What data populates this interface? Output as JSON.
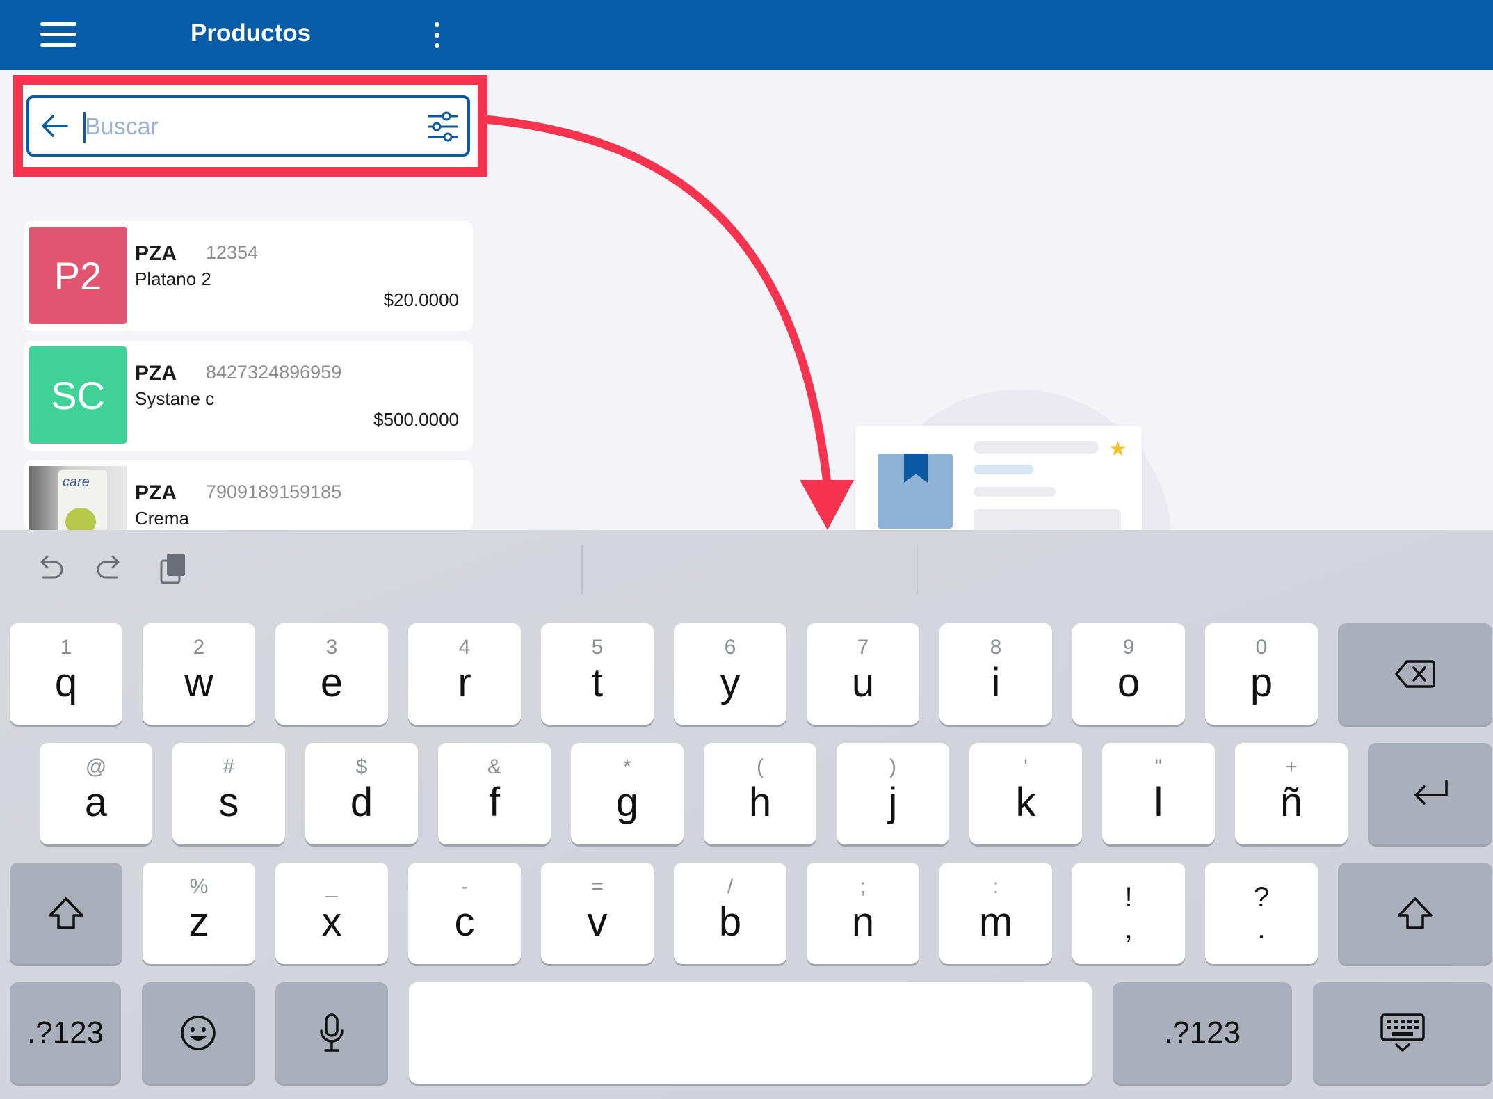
{
  "appbar": {
    "title": "Productos",
    "menu_icon": "hamburger-menu-icon",
    "overflow_icon": "more-vertical-icon",
    "color": "#075ca8"
  },
  "search": {
    "placeholder": "Buscar",
    "value": "",
    "back_icon": "arrow-left-icon",
    "filter_icon": "sliders-filter-icon",
    "highlight_color": "#f6344f"
  },
  "products": [
    {
      "initials": "P2",
      "unit": "PZA",
      "code": "12354",
      "name": "Platano 2",
      "price": "$20.0000",
      "color": "#e05670"
    },
    {
      "initials": "SC",
      "unit": "PZA",
      "code": "8427324896959",
      "name": "Systane c",
      "price": "$500.0000",
      "color": "#40d197"
    },
    {
      "initials": "",
      "unit": "PZA",
      "code": "7909189159185",
      "name": "Crema",
      "price": "",
      "photo_text": "care"
    }
  ],
  "keyboard": {
    "toolbar": [
      "undo-icon",
      "redo-icon",
      "clipboard-icon"
    ],
    "row1": [
      {
        "hint": "1",
        "key": "q"
      },
      {
        "hint": "2",
        "key": "w"
      },
      {
        "hint": "3",
        "key": "e"
      },
      {
        "hint": "4",
        "key": "r"
      },
      {
        "hint": "5",
        "key": "t"
      },
      {
        "hint": "6",
        "key": "y"
      },
      {
        "hint": "7",
        "key": "u"
      },
      {
        "hint": "8",
        "key": "i"
      },
      {
        "hint": "9",
        "key": "o"
      },
      {
        "hint": "0",
        "key": "p"
      }
    ],
    "row2": [
      {
        "hint": "@",
        "key": "a"
      },
      {
        "hint": "#",
        "key": "s"
      },
      {
        "hint": "$",
        "key": "d"
      },
      {
        "hint": "&",
        "key": "f"
      },
      {
        "hint": "*",
        "key": "g"
      },
      {
        "hint": "(",
        "key": "h"
      },
      {
        "hint": ")",
        "key": "j"
      },
      {
        "hint": "'",
        "key": "k"
      },
      {
        "hint": "\"",
        "key": "l"
      },
      {
        "hint": "+",
        "key": "ñ"
      }
    ],
    "row3": [
      {
        "hint": "%",
        "key": "z"
      },
      {
        "hint": "_",
        "key": "x"
      },
      {
        "hint": "-",
        "key": "c"
      },
      {
        "hint": "=",
        "key": "v"
      },
      {
        "hint": "/",
        "key": "b"
      },
      {
        "hint": ";",
        "key": "n"
      },
      {
        "hint": ":",
        "key": "m"
      },
      {
        "hint": "!",
        "key": ","
      },
      {
        "hint": "?",
        "key": "."
      }
    ],
    "symbols_label": ".?123",
    "symbols_label_right": ".?123",
    "space_label": ""
  }
}
